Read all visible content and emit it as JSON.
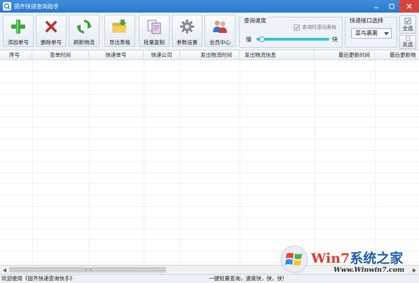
{
  "window": {
    "title": "固齐快递查询助手",
    "controls": [
      "minimize",
      "maximize",
      "close"
    ]
  },
  "toolbar": {
    "buttons": [
      {
        "label": "添加单号",
        "icon": "plus-icon"
      },
      {
        "label": "删除单号",
        "icon": "delete-x-icon"
      },
      {
        "label": "刷新物流",
        "icon": "refresh-icon"
      },
      {
        "label": "导出表格",
        "icon": "export-folder-icon"
      },
      {
        "label": "批量复制",
        "icon": "copy-icon"
      },
      {
        "label": "参数设置",
        "icon": "gear-icon"
      },
      {
        "label": "会员中心",
        "icon": "members-icon"
      }
    ]
  },
  "speed_panel": {
    "title": "查询速度",
    "checkbox_label": "查询时滚动表格",
    "checkbox_checked": true,
    "slow_label": "慢",
    "fast_label": "快",
    "speed_level": 0.08,
    "colors": {
      "track": "#2fc3d6"
    }
  },
  "api_panel": {
    "title": "快递接口选择",
    "selected": "菜鸟裹裹"
  },
  "side_buttons": {
    "select_all": "全选",
    "invert": "反选"
  },
  "table": {
    "columns": [
      "序号",
      "查单时间",
      "快递单号",
      "快递公司",
      "发出物流时间",
      "发出物流信息",
      "最后更新时间",
      "最后更新物"
    ],
    "rows": []
  },
  "status": {
    "left": "欢迎使用《固齐快递查询快手》",
    "right": "一键批量查询，速度快，快，快!"
  },
  "watermark": {
    "brand_main": "Win7",
    "brand_rest": "系统之家",
    "site": "Www.Winwin7.com"
  }
}
